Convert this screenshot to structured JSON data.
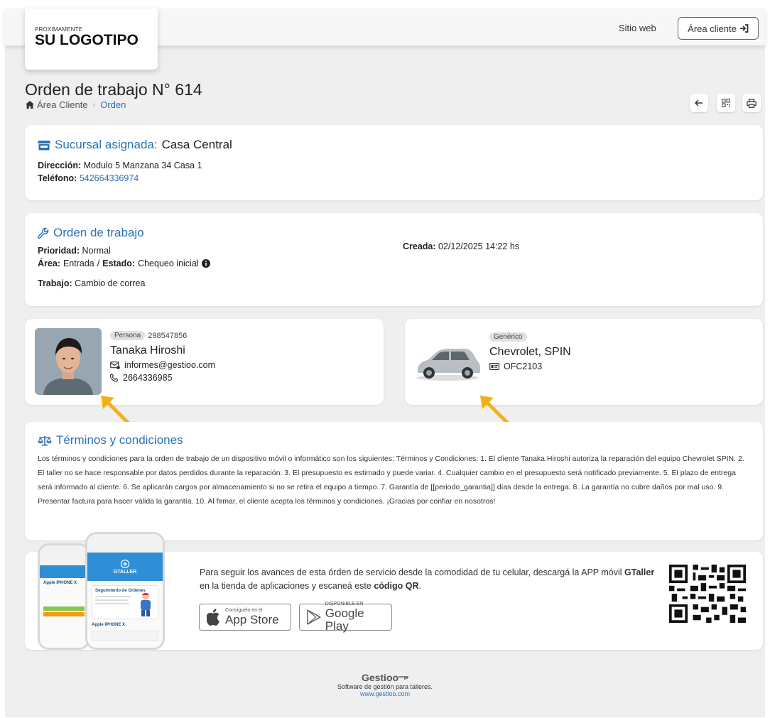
{
  "header": {
    "logo_small": "PROXIMAMENTE",
    "logo_big": "SU LOGOTIPO",
    "nav_website": "Sitio web",
    "client_area_button": "Área cliente"
  },
  "page": {
    "title": "Orden de trabajo N° 614",
    "breadcrumb": [
      {
        "label": "Área Cliente"
      },
      {
        "label": "Orden"
      }
    ]
  },
  "branch": {
    "title_label": "Sucursal asignada:",
    "title_value": "Casa Central",
    "address_label": "Dirección:",
    "address_value": "Modulo 5 Manzana 34 Casa 1",
    "phone_label": "Teléfono:",
    "phone_value": "542664336974"
  },
  "order": {
    "title": "Orden de trabajo",
    "priority_label": "Prioridad:",
    "priority_value": "Normal",
    "area_label": "Área:",
    "area_value": "Entrada",
    "state_label": "Estado:",
    "state_value": "Chequeo inicial",
    "created_label": "Creada:",
    "created_value": "02/12/2025 14:22 hs",
    "work_label": "Trabajo:",
    "work_value": "Cambio de correa"
  },
  "client": {
    "badge": "Persona",
    "id": "298547856",
    "name": "Tanaka Hiroshi",
    "email": "informes@gestioo.com",
    "phone": "2664336985"
  },
  "vehicle": {
    "badge": "Genérico",
    "name": "Chevrolet, SPIN",
    "plate": "OFC2103"
  },
  "terms": {
    "title": "Términos y condiciones",
    "text": "Los términos y condiciones para la orden de trabajo de un dispositivo móvil o informático son los siguientes: Términos y Condiciones: 1. El cliente Tanaka Hiroshi autoriza la reparación del equipo Chevrolet SPIN. 2. El taller no se hace responsable por datos perdidos durante la reparación. 3. El presupuesto es estimado y puede variar. 4. Cualquier cambio en el presupuesto será notificado previamente. 5. El plazo de entrega será informado al cliente. 6. Se aplicarán cargos por almacenamiento si no se retira el equipo a tiempo. 7. Garantía de [[periodo_garantia]] días desde la entrega. 8. La garantía no cubre daños por mal uso. 9. Presentar factura para hacer válida la garantía. 10. Al firmar, el cliente acepta los términos y condiciones. ¡Gracias por confiar en nosotros!"
  },
  "app_promo": {
    "text_before": "Para seguir los avances de esta órden de servicio desde la comodidad de tu celular, descargá la APP móvil ",
    "app_name": "GTaller",
    "text_middle": " en la tienda de aplicaciones y escaneá este ",
    "qr_label": "código QR",
    "text_end": ".",
    "appstore_small": "Consíguelo en el",
    "appstore_big": "App Store",
    "googleplay_small": "DISPONIBLE EN",
    "googleplay_big": "Google Play",
    "phone_brand": "GTALLER",
    "phone_left_title": "Apple IPHONE X",
    "phone_right_title": "Seguimiento de Ordenes",
    "phone_right_item": "Apple IPHONE X"
  },
  "footer": {
    "brand": "Gestioo",
    "subtitle": "Software de gestión para talleres.",
    "link": "www.gestioo.com"
  },
  "colors": {
    "accent": "#2a72b8",
    "arrow": "#f5b014"
  }
}
